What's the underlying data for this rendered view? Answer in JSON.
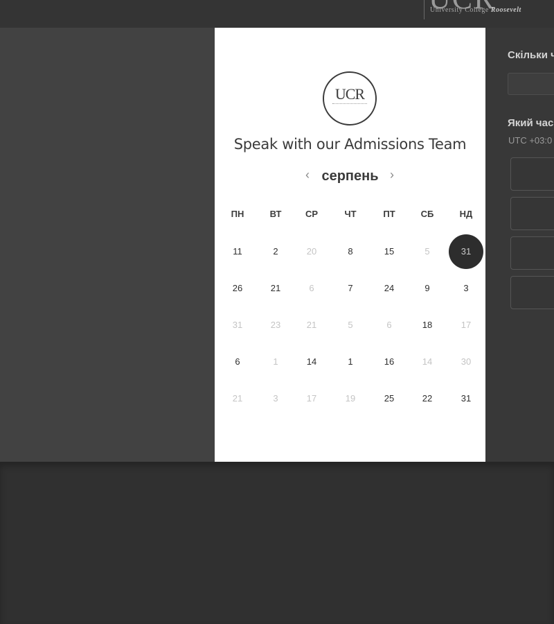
{
  "header": {
    "logo_mark": "UCR",
    "logo_text_plain": "University College",
    "logo_text_bold": "Roosevelt"
  },
  "card": {
    "logo_text": "UCR",
    "title": "Speak with our Admissions Team",
    "month": "серпень",
    "prev_icon": "‹",
    "next_icon": "›",
    "weekdays": [
      "ПН",
      "ВТ",
      "СР",
      "ЧТ",
      "ПТ",
      "СБ",
      "НД"
    ],
    "weeks": [
      [
        {
          "d": "11",
          "m": false
        },
        {
          "d": "2",
          "m": false
        },
        {
          "d": "20",
          "m": true
        },
        {
          "d": "8",
          "m": false
        },
        {
          "d": "15",
          "m": false
        },
        {
          "d": "5",
          "m": true
        },
        {
          "d": "31",
          "m": false,
          "selected": true
        }
      ],
      [
        {
          "d": "26",
          "m": false
        },
        {
          "d": "21",
          "m": false
        },
        {
          "d": "6",
          "m": true
        },
        {
          "d": "7",
          "m": false
        },
        {
          "d": "24",
          "m": false
        },
        {
          "d": "9",
          "m": false
        },
        {
          "d": "3",
          "m": false
        }
      ],
      [
        {
          "d": "31",
          "m": true
        },
        {
          "d": "23",
          "m": true
        },
        {
          "d": "21",
          "m": true
        },
        {
          "d": "5",
          "m": true
        },
        {
          "d": "6",
          "m": true
        },
        {
          "d": "18",
          "m": false
        },
        {
          "d": "17",
          "m": true
        }
      ],
      [
        {
          "d": "6",
          "m": false
        },
        {
          "d": "1",
          "m": true
        },
        {
          "d": "14",
          "m": false
        },
        {
          "d": "1",
          "m": false
        },
        {
          "d": "16",
          "m": false
        },
        {
          "d": "14",
          "m": true
        },
        {
          "d": "30",
          "m": true
        }
      ],
      [
        {
          "d": "21",
          "m": true
        },
        {
          "d": "3",
          "m": true
        },
        {
          "d": "17",
          "m": true
        },
        {
          "d": "19",
          "m": true
        },
        {
          "d": "25",
          "m": false
        },
        {
          "d": "22",
          "m": false
        },
        {
          "d": "31",
          "m": false
        }
      ]
    ]
  },
  "side_panel": {
    "duration_label": "Скільки ч",
    "time_label": "Який час",
    "timezone": "UTC +03:0"
  },
  "colors": {
    "selected_day_bg": "#2d2d2d",
    "muted_day": "#c4c4c4"
  }
}
